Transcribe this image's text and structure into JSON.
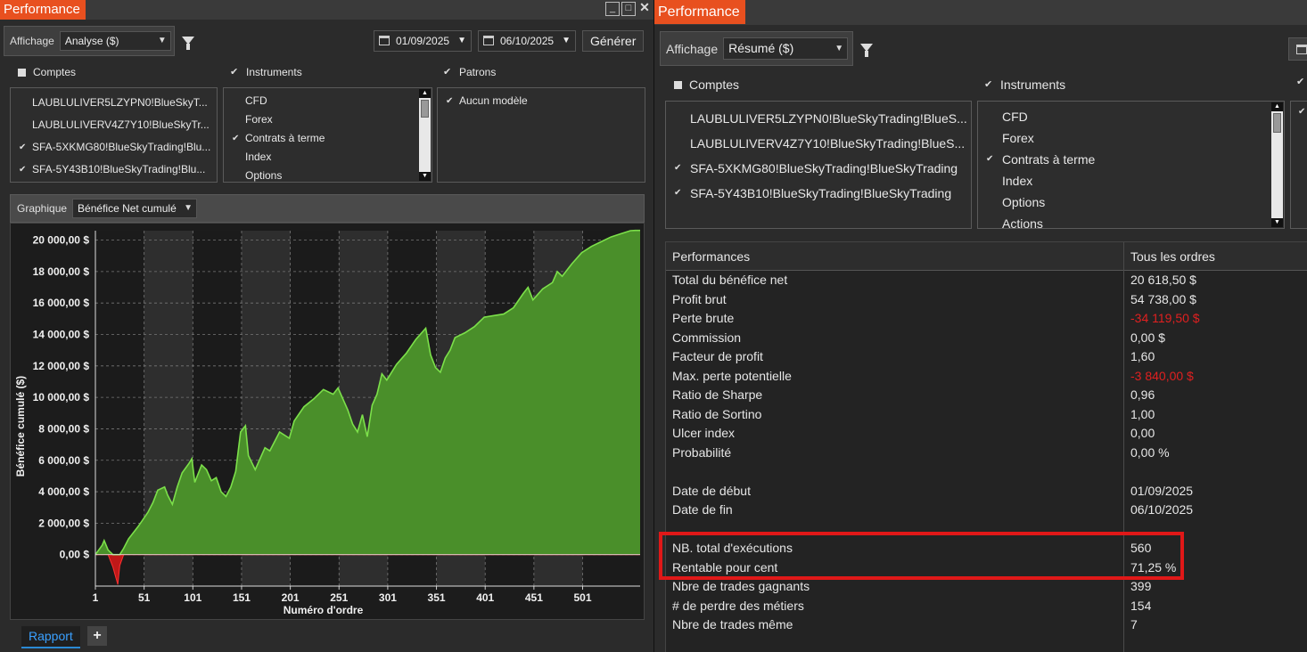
{
  "left": {
    "title": "Performance",
    "toolbar": {
      "display_label": "Affichage",
      "display_value": "Analyse ($)",
      "start_date": "01/09/2025",
      "end_date": "06/10/2025",
      "generate_label": "Générer"
    },
    "sections": {
      "accounts": "Comptes",
      "instruments": "Instruments",
      "patterns": "Patrons"
    },
    "accounts": [
      {
        "label": "LAUBLULIVER5LZYPN0!BlueSkyT...",
        "checked": false
      },
      {
        "label": "LAUBLULIVERV4Z7Y10!BlueSkyTr...",
        "checked": false
      },
      {
        "label": "SFA-5XKMG80!BlueSkyTrading!Blu...",
        "checked": true
      },
      {
        "label": "SFA-5Y43B10!BlueSkyTrading!Blu...",
        "checked": true
      }
    ],
    "instruments": [
      {
        "label": "CFD",
        "checked": false
      },
      {
        "label": "Forex",
        "checked": false
      },
      {
        "label": "Contrats à terme",
        "checked": true
      },
      {
        "label": "Index",
        "checked": false
      },
      {
        "label": "Options",
        "checked": false
      }
    ],
    "patterns": [
      {
        "label": "Aucun modèle",
        "checked": true
      }
    ],
    "graph": {
      "label": "Graphique",
      "value": "Bénéfice Net cumulé"
    },
    "tabs": {
      "report": "Rapport",
      "add": "+"
    }
  },
  "chart_data": {
    "type": "area",
    "title": "",
    "xlabel": "Numéro d'ordre",
    "ylabel": "Bénéfice cumulé ($)",
    "ylim": [
      -2000,
      20600
    ],
    "xlim": [
      1,
      560
    ],
    "y_ticks": [
      "0,00 $",
      "2 000,00 $",
      "4 000,00 $",
      "6 000,00 $",
      "8 000,00 $",
      "10 000,00 $",
      "12 000,00 $",
      "14 000,00 $",
      "16 000,00 $",
      "18 000,00 $",
      "20 000,00 $"
    ],
    "x_ticks": [
      "1",
      "51",
      "101",
      "151",
      "201",
      "251",
      "301",
      "351",
      "401",
      "451",
      "501"
    ],
    "x": [
      1,
      8,
      10,
      14,
      19,
      24,
      26,
      30,
      35,
      45,
      55,
      60,
      65,
      72,
      75,
      80,
      85,
      90,
      97,
      100,
      103,
      110,
      115,
      120,
      125,
      130,
      135,
      140,
      145,
      150,
      155,
      158,
      165,
      170,
      175,
      180,
      190,
      200,
      205,
      215,
      225,
      235,
      245,
      250,
      260,
      265,
      270,
      275,
      280,
      285,
      290,
      295,
      300,
      310,
      320,
      330,
      340,
      345,
      350,
      355,
      360,
      365,
      370,
      380,
      390,
      400,
      410,
      420,
      430,
      440,
      445,
      450,
      460,
      470,
      475,
      480,
      490,
      500,
      510,
      520,
      530,
      540,
      550,
      555,
      560
    ],
    "y": [
      0,
      600,
      900,
      300,
      -800,
      -1900,
      -700,
      400,
      1000,
      1800,
      2700,
      3300,
      4100,
      4300,
      3800,
      3200,
      4300,
      5200,
      5800,
      6100,
      4600,
      5700,
      5400,
      4700,
      4900,
      4000,
      3700,
      4300,
      5300,
      7800,
      8200,
      6300,
      5400,
      6100,
      6800,
      6600,
      7800,
      7400,
      8500,
      9400,
      9900,
      10500,
      10200,
      10600,
      9200,
      8300,
      7800,
      8900,
      7500,
      9500,
      10200,
      11500,
      11100,
      12100,
      12800,
      13700,
      14400,
      12700,
      11900,
      11600,
      12500,
      13000,
      13800,
      14100,
      14500,
      15100,
      15200,
      15300,
      15700,
      16600,
      17000,
      16200,
      16900,
      17300,
      18000,
      17700,
      18500,
      19200,
      19600,
      19900,
      20200,
      20400,
      20600,
      20618.5,
      20618.5
    ],
    "colors": {
      "positive_fill": "#4a8f2a",
      "positive_line": "#7ce04a",
      "negative_fill": "#c01818",
      "band": "#2e2e2e"
    }
  },
  "right": {
    "title": "Performance",
    "toolbar": {
      "display_label": "Affichage",
      "display_value": "Résumé ($)"
    },
    "sections": {
      "accounts": "Comptes",
      "instruments": "Instruments"
    },
    "accounts": [
      {
        "label": "LAUBLULIVER5LZYPN0!BlueSkyTrading!BlueS...",
        "checked": false
      },
      {
        "label": "LAUBLULIVERV4Z7Y10!BlueSkyTrading!BlueS...",
        "checked": false
      },
      {
        "label": "SFA-5XKMG80!BlueSkyTrading!BlueSkyTrading",
        "checked": true
      },
      {
        "label": "SFA-5Y43B10!BlueSkyTrading!BlueSkyTrading",
        "checked": true
      }
    ],
    "instruments": [
      {
        "label": "CFD",
        "checked": false
      },
      {
        "label": "Forex",
        "checked": false
      },
      {
        "label": "Contrats à terme",
        "checked": true
      },
      {
        "label": "Index",
        "checked": false
      },
      {
        "label": "Options",
        "checked": false
      },
      {
        "label": "Actions",
        "checked": false
      }
    ],
    "table": {
      "col1": "Performances",
      "col2": "Tous les ordres",
      "rows": [
        {
          "k": "Total du bénéfice net",
          "v": "20 618,50 $",
          "neg": false
        },
        {
          "k": "Profit brut",
          "v": "54 738,00 $",
          "neg": false
        },
        {
          "k": "Perte brute",
          "v": "-34 119,50 $",
          "neg": true
        },
        {
          "k": "Commission",
          "v": "0,00 $",
          "neg": false
        },
        {
          "k": "Facteur de profit",
          "v": "1,60",
          "neg": false
        },
        {
          "k": "Max. perte potentielle",
          "v": "-3 840,00 $",
          "neg": true
        },
        {
          "k": "Ratio de Sharpe",
          "v": "0,96",
          "neg": false
        },
        {
          "k": "Ratio de Sortino",
          "v": "1,00",
          "neg": false
        },
        {
          "k": "Ulcer index",
          "v": "0,00",
          "neg": false
        },
        {
          "k": "Probabilité",
          "v": "0,00 %",
          "neg": false
        },
        {
          "k": "",
          "v": "",
          "neg": false
        },
        {
          "k": "Date de début",
          "v": "01/09/2025",
          "neg": false
        },
        {
          "k": "Date de fin",
          "v": "06/10/2025",
          "neg": false
        },
        {
          "k": "",
          "v": "",
          "neg": false
        },
        {
          "k": "NB. total d'exécutions",
          "v": "560",
          "neg": false
        },
        {
          "k": "Rentable pour cent",
          "v": "71,25 %",
          "neg": false
        },
        {
          "k": "Nbre de trades gagnants",
          "v": "399",
          "neg": false
        },
        {
          "k": "# de perdre des métiers",
          "v": "154",
          "neg": false
        },
        {
          "k": "Nbre de trades même",
          "v": "7",
          "neg": false
        }
      ]
    }
  }
}
